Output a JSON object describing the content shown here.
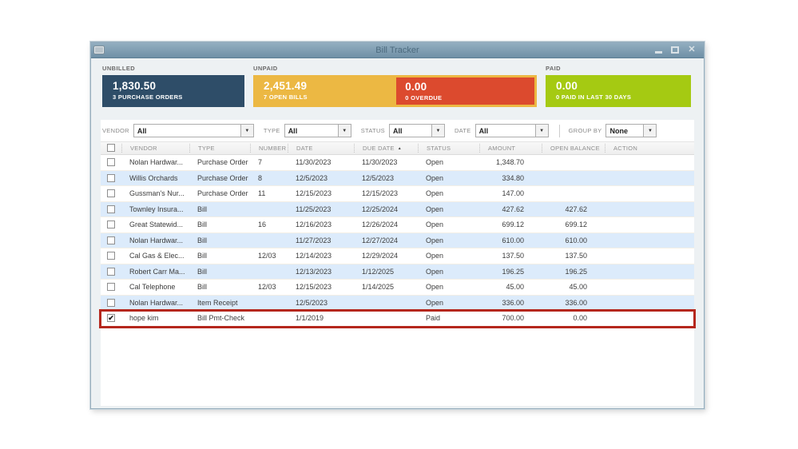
{
  "window": {
    "title": "Bill Tracker",
    "controls": {
      "minimize": "minimize",
      "maximize": "maximize",
      "close": "close"
    }
  },
  "summary": {
    "unbilled": {
      "label": "UNBILLED",
      "amount": "1,830.50",
      "sub": "3 PURCHASE ORDERS",
      "color": "#2e4d68"
    },
    "unpaid": {
      "label": "UNPAID",
      "amount": "2,451.49",
      "sub": "7 OPEN BILLS",
      "color": "#ecb843"
    },
    "overdue": {
      "amount": "0.00",
      "sub": "0 OVERDUE",
      "color": "#dc4a2e"
    },
    "paid": {
      "label": "PAID",
      "amount": "0.00",
      "sub": "0 PAID IN LAST 30 DAYS",
      "color": "#a5ca12"
    }
  },
  "filters": [
    {
      "id": "vendor",
      "label": "VENDOR",
      "value": "All"
    },
    {
      "id": "type",
      "label": "TYPE",
      "value": "All"
    },
    {
      "id": "status",
      "label": "STATUS",
      "value": "All"
    },
    {
      "id": "date",
      "label": "DATE",
      "value": "All"
    },
    {
      "id": "group",
      "label": "GROUP BY",
      "value": "None"
    }
  ],
  "table": {
    "columns": [
      {
        "key": "vendor",
        "label": "VENDOR"
      },
      {
        "key": "type",
        "label": "TYPE"
      },
      {
        "key": "number",
        "label": "NUMBER"
      },
      {
        "key": "date",
        "label": "DATE"
      },
      {
        "key": "due_date",
        "label": "DUE DATE",
        "sort": "asc"
      },
      {
        "key": "status",
        "label": "STATUS"
      },
      {
        "key": "amount",
        "label": "AMOUNT",
        "align": "right"
      },
      {
        "key": "open_balance",
        "label": "OPEN BALANCE",
        "align": "right"
      },
      {
        "key": "action",
        "label": "ACTION"
      }
    ],
    "rows": [
      {
        "checked": false,
        "highlight": false,
        "vendor": "Nolan Hardwar...",
        "type": "Purchase Order",
        "number": "7",
        "date": "11/30/2023",
        "due_date": "11/30/2023",
        "status": "Open",
        "amount": "1,348.70",
        "open_balance": "",
        "action": ""
      },
      {
        "checked": false,
        "highlight": false,
        "vendor": "Willis Orchards",
        "type": "Purchase Order",
        "number": "8",
        "date": "12/5/2023",
        "due_date": "12/5/2023",
        "status": "Open",
        "amount": "334.80",
        "open_balance": "",
        "action": ""
      },
      {
        "checked": false,
        "highlight": false,
        "vendor": "Gussman's Nur...",
        "type": "Purchase Order",
        "number": "11",
        "date": "12/15/2023",
        "due_date": "12/15/2023",
        "status": "Open",
        "amount": "147.00",
        "open_balance": "",
        "action": ""
      },
      {
        "checked": false,
        "highlight": false,
        "vendor": "Townley Insura...",
        "type": "Bill",
        "number": "",
        "date": "11/25/2023",
        "due_date": "12/25/2024",
        "status": "Open",
        "amount": "427.62",
        "open_balance": "427.62",
        "action": ""
      },
      {
        "checked": false,
        "highlight": false,
        "vendor": "Great Statewid...",
        "type": "Bill",
        "number": "16",
        "date": "12/16/2023",
        "due_date": "12/26/2024",
        "status": "Open",
        "amount": "699.12",
        "open_balance": "699.12",
        "action": ""
      },
      {
        "checked": false,
        "highlight": false,
        "vendor": "Nolan Hardwar...",
        "type": "Bill",
        "number": "",
        "date": "11/27/2023",
        "due_date": "12/27/2024",
        "status": "Open",
        "amount": "610.00",
        "open_balance": "610.00",
        "action": ""
      },
      {
        "checked": false,
        "highlight": false,
        "vendor": "Cal Gas & Elec...",
        "type": "Bill",
        "number": "12/03",
        "date": "12/14/2023",
        "due_date": "12/29/2024",
        "status": "Open",
        "amount": "137.50",
        "open_balance": "137.50",
        "action": ""
      },
      {
        "checked": false,
        "highlight": false,
        "vendor": "Robert Carr Ma...",
        "type": "Bill",
        "number": "",
        "date": "12/13/2023",
        "due_date": "1/12/2025",
        "status": "Open",
        "amount": "196.25",
        "open_balance": "196.25",
        "action": ""
      },
      {
        "checked": false,
        "highlight": false,
        "vendor": "Cal Telephone",
        "type": "Bill",
        "number": "12/03",
        "date": "12/15/2023",
        "due_date": "1/14/2025",
        "status": "Open",
        "amount": "45.00",
        "open_balance": "45.00",
        "action": ""
      },
      {
        "checked": false,
        "highlight": false,
        "vendor": "Nolan Hardwar...",
        "type": "Item Receipt",
        "number": "",
        "date": "12/5/2023",
        "due_date": "",
        "status": "Open",
        "amount": "336.00",
        "open_balance": "336.00",
        "action": ""
      },
      {
        "checked": true,
        "highlight": true,
        "vendor": "hope kim",
        "type": "Bill Pmt-Check",
        "number": "",
        "date": "1/1/2019",
        "due_date": "",
        "status": "Paid",
        "amount": "700.00",
        "open_balance": "0.00",
        "action": ""
      }
    ]
  },
  "colors": {
    "highlight_border": "#b5271d",
    "row_alt": "#dcebfb",
    "titlebar_top": "#94afc1",
    "titlebar_bottom": "#6f90a6"
  }
}
